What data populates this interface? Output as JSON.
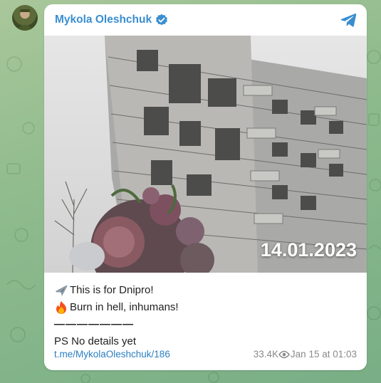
{
  "channel": {
    "name": "Mykola Oleshchuk",
    "verified_icon": "verified-icon",
    "app_icon": "telegram-icon"
  },
  "post": {
    "photo_date": "14.01.2023",
    "lines": [
      "This is for Dnipro!",
      "Burn in hell, inhumans!",
      "———————",
      "PS No details yet"
    ],
    "link": "t.me/MykolaOleshchuk/186",
    "views": "33.4K",
    "timestamp": "Jan 15 at 01:03"
  },
  "colors": {
    "accent": "#3a8ed0",
    "link": "#2a7ec1",
    "muted": "#8a8a8a"
  }
}
